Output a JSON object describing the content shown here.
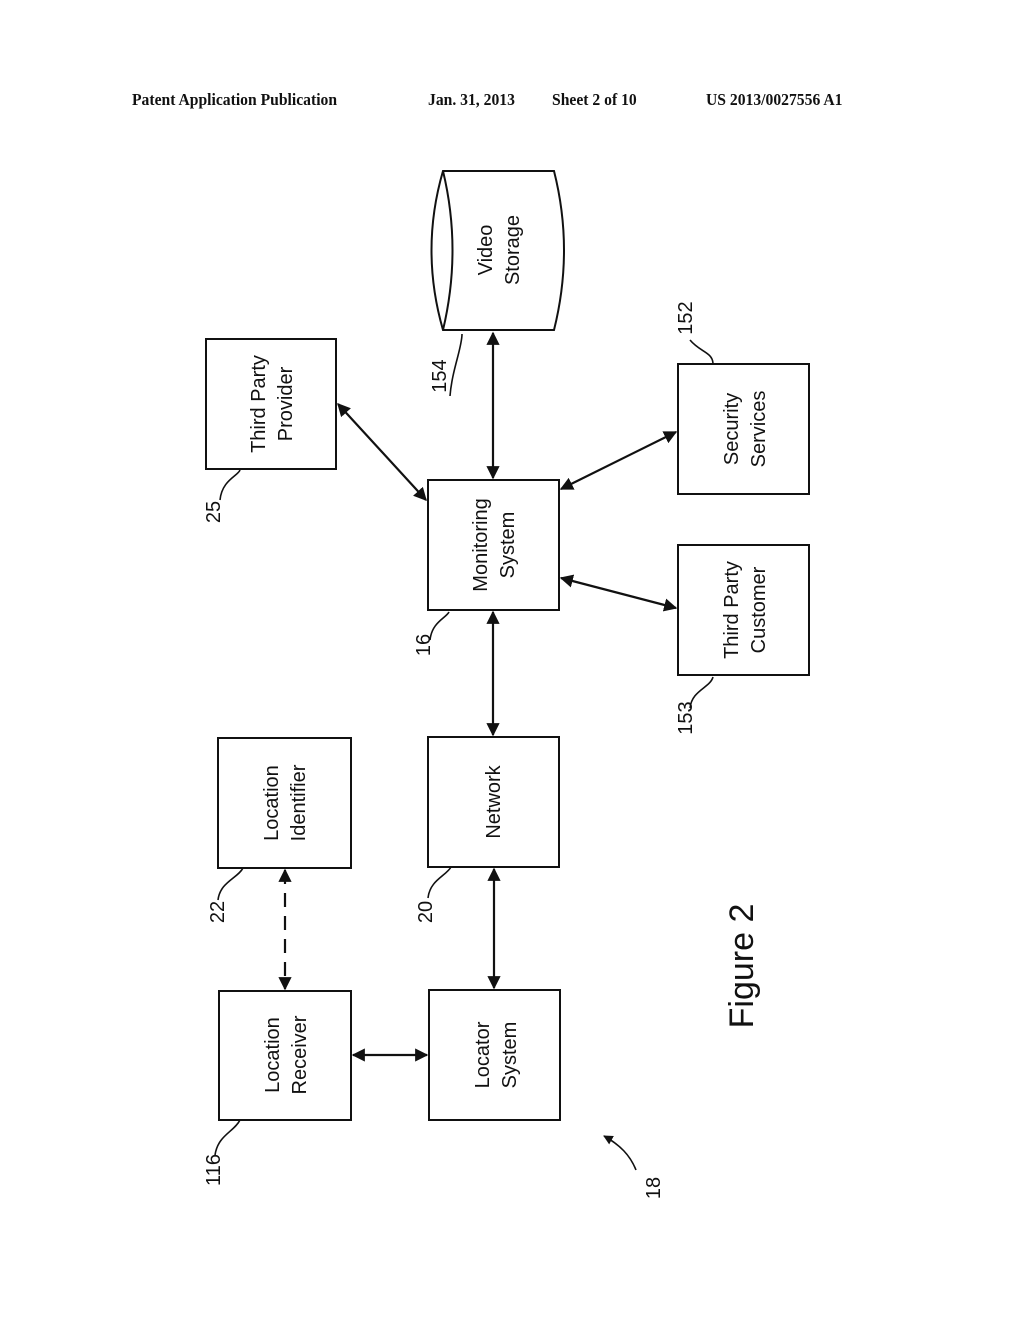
{
  "header": {
    "publication": "Patent Application Publication",
    "date": "Jan. 31, 2013",
    "sheet": "Sheet 2 of 10",
    "number": "US 2013/0027556 A1"
  },
  "figure": {
    "caption": "Figure 2",
    "system_ref": "18"
  },
  "nodes": {
    "video_storage": {
      "line1": "Video",
      "line2": "Storage",
      "ref": "154",
      "shape": "cylinder"
    },
    "third_party_provider": {
      "line1": "Third Party",
      "line2": "Provider",
      "ref": "25"
    },
    "monitoring_system": {
      "line1": "Monitoring",
      "line2": "System",
      "ref": "16"
    },
    "security_services": {
      "line1": "Security",
      "line2": "Services",
      "ref": "152"
    },
    "third_party_customer": {
      "line1": "Third Party",
      "line2": "Customer",
      "ref": "153"
    },
    "location_identifier": {
      "line1": "Location",
      "line2": "Identifier",
      "ref": "22"
    },
    "network": {
      "line1": "Network",
      "line2": "",
      "ref": "20"
    },
    "location_receiver": {
      "line1": "Location",
      "line2": "Receiver",
      "ref": "116"
    },
    "locator_system": {
      "line1": "Locator",
      "line2": "System",
      "ref": ""
    }
  },
  "edges": [
    {
      "from": "monitoring_system",
      "to": "video_storage",
      "style": "solid",
      "arrows": "both"
    },
    {
      "from": "monitoring_system",
      "to": "third_party_provider",
      "style": "solid",
      "arrows": "both"
    },
    {
      "from": "monitoring_system",
      "to": "security_services",
      "style": "solid",
      "arrows": "both"
    },
    {
      "from": "monitoring_system",
      "to": "third_party_customer",
      "style": "solid",
      "arrows": "both"
    },
    {
      "from": "monitoring_system",
      "to": "network",
      "style": "solid",
      "arrows": "both"
    },
    {
      "from": "network",
      "to": "locator_system",
      "style": "solid",
      "arrows": "both"
    },
    {
      "from": "locator_system",
      "to": "location_receiver",
      "style": "solid",
      "arrows": "both"
    },
    {
      "from": "location_receiver",
      "to": "location_identifier",
      "style": "dashed",
      "arrows": "both"
    }
  ]
}
